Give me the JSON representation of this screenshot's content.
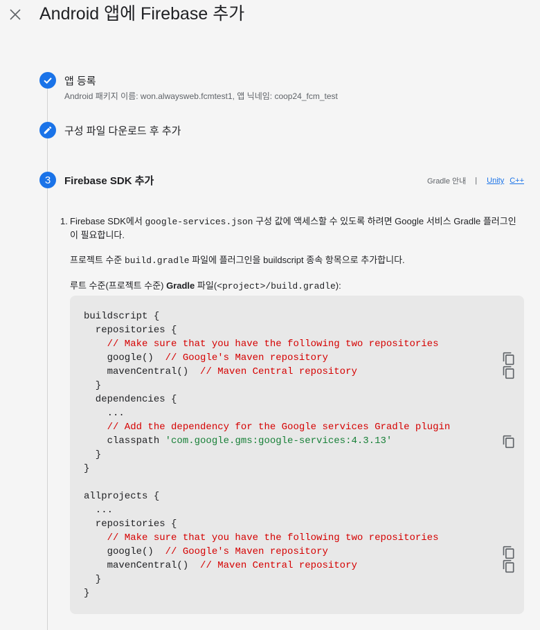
{
  "header": {
    "title": "Android 앱에 Firebase 추가",
    "close_icon": "close-icon"
  },
  "steps": [
    {
      "status": "done",
      "icon": "check-icon",
      "title": "앱 등록",
      "subtitle": "Android 패키지 이름: won.alwaysweb.fcmtest1, 앱 닉네임: coop24_fcm_test"
    },
    {
      "status": "edit",
      "icon": "pencil-icon",
      "title": "구성 파일 다운로드 후 추가"
    },
    {
      "status": "active",
      "number": "3",
      "title": "Firebase SDK 추가"
    }
  ],
  "guide": {
    "label": "Gradle 안내",
    "separator": "|",
    "unity": "Unity",
    "cpp": "C++"
  },
  "instructions": {
    "item_number": "1.",
    "para1_a": "Firebase SDK에서 ",
    "para1_code": "google-services.json",
    "para1_b": " 구성 값에 액세스할 수 있도록 하려면 Google 서비스 Gradle 플러그인이 필요합니다.",
    "para2_a": "프로젝트 수준 ",
    "para2_code": "build.gradle",
    "para2_b": " 파일에 플러그인을 buildscript 종속 항목으로 추가합니다.",
    "para3_a": "루트 수준(프로젝트 수준) ",
    "para3_bold": "Gradle",
    "para3_b": " 파일(",
    "para3_code": "<project>/build.gradle",
    "para3_c": "):"
  },
  "code": {
    "lines": [
      {
        "text": "buildscript {"
      },
      {
        "text": "  repositories {"
      },
      {
        "text": "    // Make sure that you have the following two repositories",
        "comment": true
      },
      {
        "text": "    google()",
        "comment_text": "  // Google's Maven repository",
        "copy": true
      },
      {
        "text": "    mavenCentral()",
        "comment_text": "  // Maven Central repository",
        "copy": true
      },
      {
        "text": "  }"
      },
      {
        "text": "  dependencies {"
      },
      {
        "text": "    ..."
      },
      {
        "text": "    // Add the dependency for the Google services Gradle plugin",
        "comment": true
      },
      {
        "text": "    classpath ",
        "string_text": "'com.google.gms:google-services:4.3.13'",
        "copy": true
      },
      {
        "text": "  }"
      },
      {
        "text": "}"
      },
      {
        "text": ""
      },
      {
        "text": "allprojects {"
      },
      {
        "text": "  ..."
      },
      {
        "text": "  repositories {"
      },
      {
        "text": "    // Make sure that you have the following two repositories",
        "comment": true
      },
      {
        "text": "    google()",
        "comment_text": "  // Google's Maven repository",
        "copy": true
      },
      {
        "text": "    mavenCentral()",
        "comment_text": "  // Maven Central repository",
        "copy": true
      },
      {
        "text": "  }"
      },
      {
        "text": "}"
      }
    ],
    "copy_icon": "copy-icon"
  },
  "colors": {
    "accent": "#1a73e8",
    "comment": "#d50000",
    "string": "#188038",
    "code_bg": "#e8e8e8"
  }
}
